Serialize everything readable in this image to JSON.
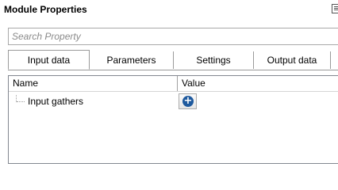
{
  "panel": {
    "title": "Module Properties",
    "dock_icon": "panel-dock-icon"
  },
  "search": {
    "placeholder": "Search Property",
    "value": ""
  },
  "tabs": [
    {
      "label": "Input data",
      "active": true
    },
    {
      "label": "Parameters",
      "active": false
    },
    {
      "label": "Settings",
      "active": false
    },
    {
      "label": "Output data",
      "active": false
    }
  ],
  "grid": {
    "columns": [
      "Name",
      "Value"
    ],
    "rows": [
      {
        "name": "Input gathers",
        "value_control": "add-icon"
      }
    ]
  },
  "colors": {
    "accent": "#1f5a9e",
    "border": "#828790"
  }
}
